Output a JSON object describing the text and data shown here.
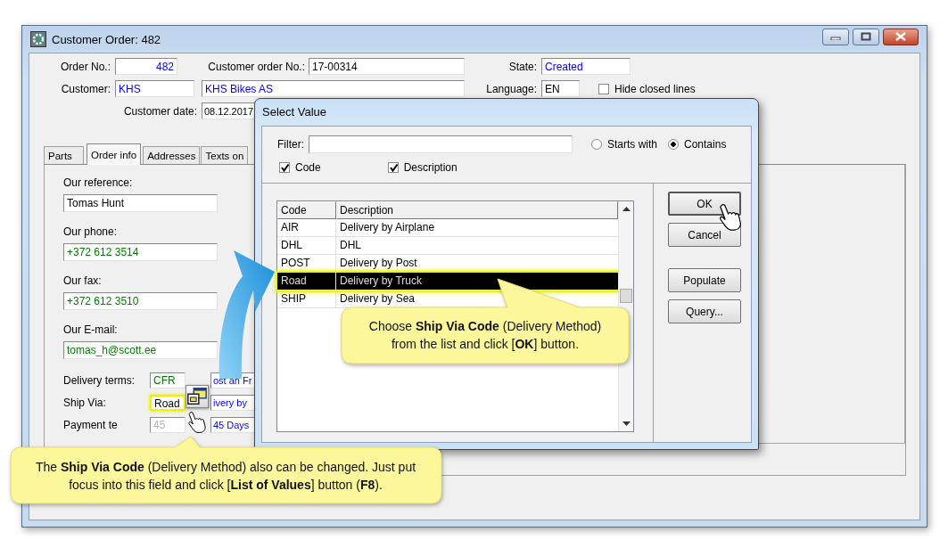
{
  "window": {
    "title": "Customer Order: 482"
  },
  "header": {
    "order_no": {
      "label": "Order No.:",
      "value": "482",
      "color": "#0000ff"
    },
    "customer_order_no": {
      "label": "Customer order No.:",
      "value": "17-00314",
      "color": "#000000"
    },
    "state": {
      "label": "State:",
      "value": "Created",
      "color": "#0000ff"
    },
    "customer": {
      "label": "Customer:",
      "code": "KHS",
      "name": "KHS Bikes AS",
      "color": "#0000ff"
    },
    "language": {
      "label": "Language:",
      "value": "EN"
    },
    "hide_closed_lines": {
      "label": "Hide closed lines",
      "checked": false
    },
    "customer_date": {
      "label": "Customer date:",
      "value": "08.12.2017"
    }
  },
  "tabs": [
    {
      "label": "Parts",
      "selected": false
    },
    {
      "label": "Order info",
      "selected": true
    },
    {
      "label": "Addresses",
      "selected": false
    },
    {
      "label": "Texts on",
      "selected": false
    }
  ],
  "order_info": {
    "fields": [
      {
        "label": "Our reference:",
        "value": "Tomas Hunt",
        "color": "#000000"
      },
      {
        "label": "Our phone:",
        "value": "+372 612 3514",
        "color": "#008000"
      },
      {
        "label": "Our fax:",
        "value": "+372 612 3510",
        "color": "#008000"
      },
      {
        "label": "Our E-mail:",
        "value": "tomas_h@scott.ee",
        "color": "#008000"
      }
    ],
    "terms": [
      {
        "label": "Delivery terms:",
        "code": "CFR",
        "color": "#008000",
        "description": "ost an Fr",
        "highlighted": false
      },
      {
        "label": "Ship Via:",
        "code": "Road",
        "color": "#000000",
        "description": "ivery by",
        "highlighted": true
      },
      {
        "label": "Payment te",
        "code": "45",
        "color": "#b4b4b4",
        "description": "45 Days",
        "highlighted": false
      }
    ]
  },
  "dialog": {
    "title": "Select Value",
    "filter_label": "Filter:",
    "match_modes": [
      {
        "label": "Starts with",
        "selected": false
      },
      {
        "label": "Contains",
        "selected": true
      }
    ],
    "search_in": [
      {
        "label": "Code",
        "checked": true
      },
      {
        "label": "Description",
        "checked": true
      }
    ],
    "table": {
      "columns": [
        "Code",
        "Description"
      ],
      "rows": [
        {
          "code": "AIR",
          "description": "Delivery by Airplane",
          "selected": false
        },
        {
          "code": "DHL",
          "description": "DHL",
          "selected": false
        },
        {
          "code": "POST",
          "description": "Delivery by Post",
          "selected": false
        },
        {
          "code": "Road",
          "description": "Delivery by Truck",
          "selected": true
        },
        {
          "code": "SHIP",
          "description": "Delivery by Sea",
          "selected": false
        }
      ]
    },
    "buttons": [
      "OK",
      "Cancel",
      "Populate",
      "Query..."
    ]
  },
  "callouts": [
    {
      "text": "Choose **Ship Via Code** (Delivery Method) from the list and click [**OK**] button."
    },
    {
      "text": "The **Ship Via Code** (Delivery Method) also can be changed.  Just put focus into this field and click [**List of Values**] button (**F8**)."
    }
  ]
}
